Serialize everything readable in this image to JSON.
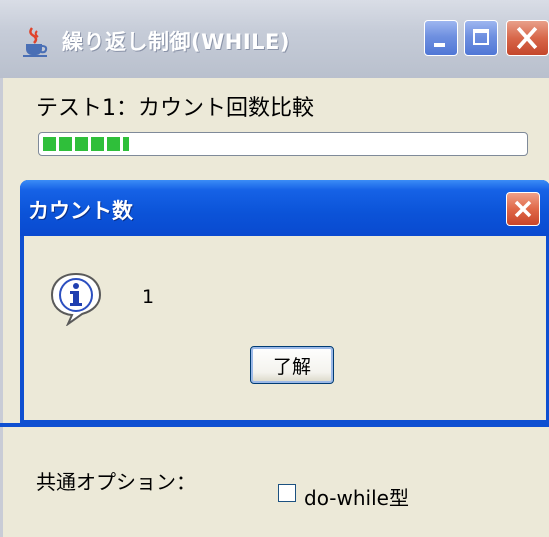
{
  "window": {
    "title": "繰り返し制御(WHILE)",
    "icon": "java-cup-icon",
    "controls": [
      "minimize-icon",
      "maximize-icon",
      "close-icon"
    ]
  },
  "main": {
    "test_label": "テスト1：カウント回数比較",
    "progress_fraction": 0.18,
    "progress_color": "#2fbf3a"
  },
  "options": {
    "label": "共通オプション：",
    "checkbox_label": "do-while型",
    "checkbox_checked": false
  },
  "dialog": {
    "title": "カウント数",
    "icon": "info-icon",
    "message": "1",
    "ok_label": "了解",
    "accent": "#0e4fd1"
  }
}
